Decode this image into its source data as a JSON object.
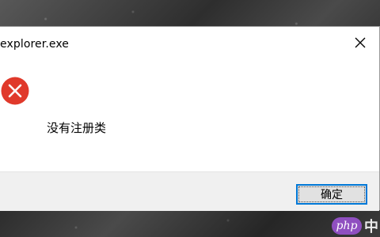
{
  "dialog": {
    "title": "explorer.exe",
    "message": "没有注册类",
    "ok_label": "确定",
    "icon": "error-icon",
    "close_icon": "close-icon"
  },
  "watermark": {
    "badge": "php",
    "text": "中"
  },
  "colors": {
    "error_red": "#e0392b",
    "focus_blue": "#0078d7",
    "footer_bg": "#f0f0f0"
  }
}
